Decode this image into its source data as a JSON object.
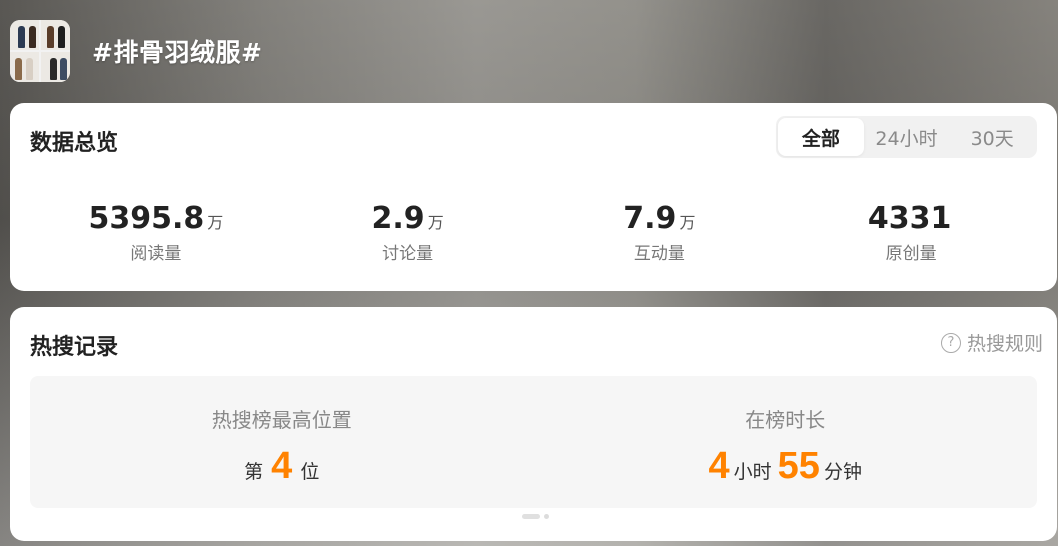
{
  "topic": {
    "title": "#排骨羽绒服#",
    "thumbnail_icon": "outfit-collage-icon"
  },
  "overview": {
    "title": "数据总览",
    "tabs": [
      {
        "label": "全部",
        "active": true
      },
      {
        "label": "24小时",
        "active": false
      },
      {
        "label": "30天",
        "active": false
      }
    ],
    "stats": [
      {
        "value": "5395.8",
        "unit": "万",
        "label": "阅读量"
      },
      {
        "value": "2.9",
        "unit": "万",
        "label": "讨论量"
      },
      {
        "value": "7.9",
        "unit": "万",
        "label": "互动量"
      },
      {
        "value": "4331",
        "unit": "",
        "label": "原创量"
      }
    ]
  },
  "hot_search": {
    "title": "热搜记录",
    "rules_label": "热搜规则",
    "help_icon": "question-circle-icon",
    "peak_position": {
      "label": "热搜榜最高位置",
      "prefix": "第",
      "value": "4",
      "suffix": "位"
    },
    "duration": {
      "label": "在榜时长",
      "hours": "4",
      "hours_unit": "小时",
      "minutes": "55",
      "minutes_unit": "分钟"
    },
    "pager": {
      "pages": 2,
      "current": 1
    }
  },
  "colors": {
    "accent_orange": "#ff8200",
    "card_bg": "#ffffff",
    "panel_bg": "#f6f6f6"
  }
}
